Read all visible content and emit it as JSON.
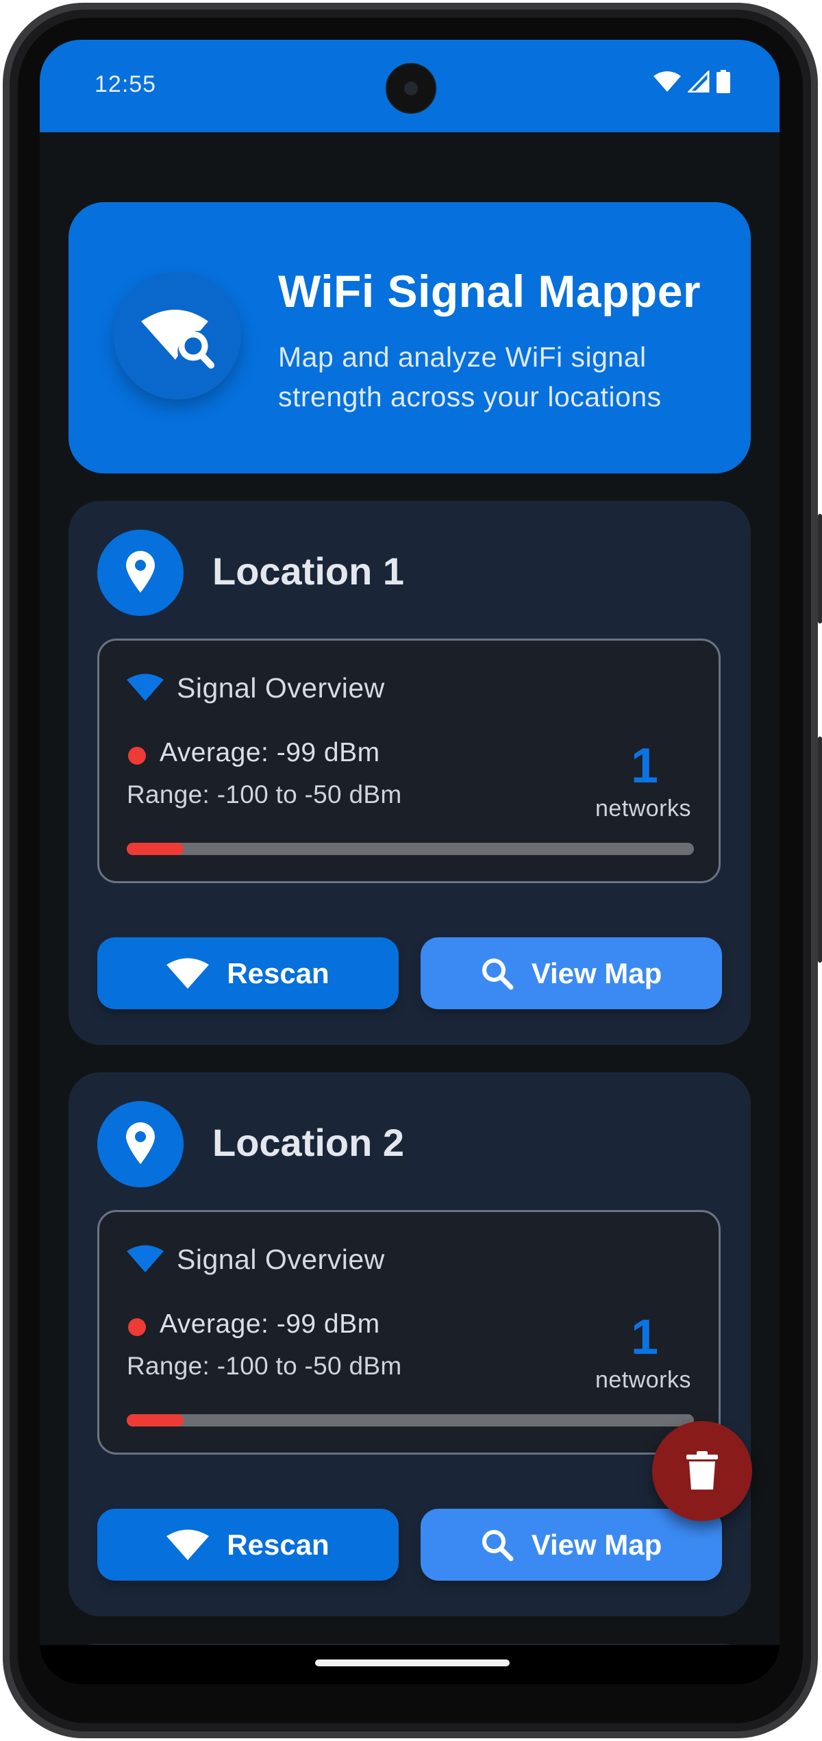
{
  "status_bar": {
    "time": "12:55",
    "icons": [
      "wifi-icon",
      "cellular-signal-icon",
      "battery-icon"
    ],
    "color": "#0670dd"
  },
  "header": {
    "title": "WiFi Signal Mapper",
    "subtitle": "Map and analyze WiFi signal strength across your locations",
    "icon": "wifi-search-icon",
    "color": "#0670dd"
  },
  "locations": [
    {
      "title": "Location 1",
      "icon": "location-pin-icon",
      "overview": {
        "title": "Signal Overview",
        "average": "Average: -99 dBm",
        "range": "Range: -100 to -50 dBm",
        "network_count": "1",
        "network_label": "networks",
        "strength_fraction": 0.1,
        "status_color": "#ef3b36"
      },
      "actions": {
        "rescan": "Rescan",
        "view_map": "View Map"
      }
    },
    {
      "title": "Location 2",
      "icon": "location-pin-icon",
      "overview": {
        "title": "Signal Overview",
        "average": "Average: -99 dBm",
        "range": "Range: -100 to -50 dBm",
        "network_count": "1",
        "network_label": "networks",
        "strength_fraction": 0.1,
        "status_color": "#ef3b36"
      },
      "actions": {
        "rescan": "Rescan",
        "view_map": "View Map"
      }
    }
  ],
  "fab": {
    "icon": "trash-icon",
    "color": "#8a1b1b"
  }
}
